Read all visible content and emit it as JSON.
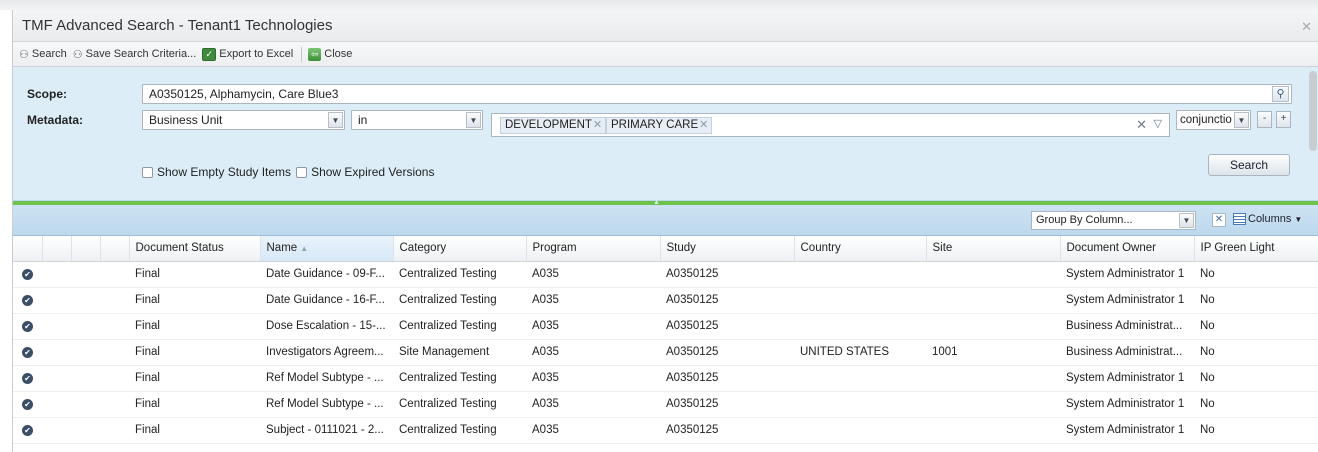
{
  "window": {
    "title": "TMF Advanced Search - Tenant1 Technologies",
    "close_icon": "close-icon"
  },
  "toolbar": {
    "search_label": "Search",
    "save_label": "Save Search Criteria...",
    "export_label": "Export to Excel",
    "close_label": "Close"
  },
  "search": {
    "scope_label": "Scope:",
    "scope_value": "A0350125, Alphamycin, Care Blue3",
    "metadata_label": "Metadata:",
    "metadata_field": "Business Unit",
    "operator": "in",
    "tags": [
      "DEVELOPMENT",
      "PRIMARY CARE"
    ],
    "conjunction": "conjunctio",
    "minus_label": "-",
    "plus_label": "+",
    "show_empty_label": "Show Empty Study Items",
    "show_expired_label": "Show Expired Versions",
    "search_button": "Search"
  },
  "grid_toolbar": {
    "group_by_placeholder": "Group By Column...",
    "columns_label": "Columns"
  },
  "grid": {
    "columns": [
      "Document Status",
      "Name",
      "Category",
      "Program",
      "Study",
      "Country",
      "Site",
      "Document Owner",
      "IP Green Light"
    ],
    "rows": [
      {
        "status": "Final",
        "name": "Date Guidance - 09-F...",
        "category": "Centralized Testing",
        "program": "A035",
        "study": "A0350125",
        "country": "",
        "site": "",
        "owner": "System Administrator 1",
        "ip": "No"
      },
      {
        "status": "Final",
        "name": "Date Guidance - 16-F...",
        "category": "Centralized Testing",
        "program": "A035",
        "study": "A0350125",
        "country": "",
        "site": "",
        "owner": "System Administrator 1",
        "ip": "No"
      },
      {
        "status": "Final",
        "name": "Dose Escalation - 15-...",
        "category": "Centralized Testing",
        "program": "A035",
        "study": "A0350125",
        "country": "",
        "site": "",
        "owner": "Business Administrat...",
        "ip": "No"
      },
      {
        "status": "Final",
        "name": "Investigators Agreem...",
        "category": "Site Management",
        "program": "A035",
        "study": "A0350125",
        "country": "UNITED STATES",
        "site": "1001",
        "owner": "Business Administrat...",
        "ip": "No"
      },
      {
        "status": "Final",
        "name": "Ref Model Subtype - ...",
        "category": "Centralized Testing",
        "program": "A035",
        "study": "A0350125",
        "country": "",
        "site": "",
        "owner": "System Administrator 1",
        "ip": "No"
      },
      {
        "status": "Final",
        "name": "Ref Model Subtype - ...",
        "category": "Centralized Testing",
        "program": "A035",
        "study": "A0350125",
        "country": "",
        "site": "",
        "owner": "System Administrator 1",
        "ip": "No"
      },
      {
        "status": "Final",
        "name": "Subject - 0111021 - 2...",
        "category": "Centralized Testing",
        "program": "A035",
        "study": "A0350125",
        "country": "",
        "site": "",
        "owner": "System Administrator 1",
        "ip": "No"
      }
    ]
  }
}
